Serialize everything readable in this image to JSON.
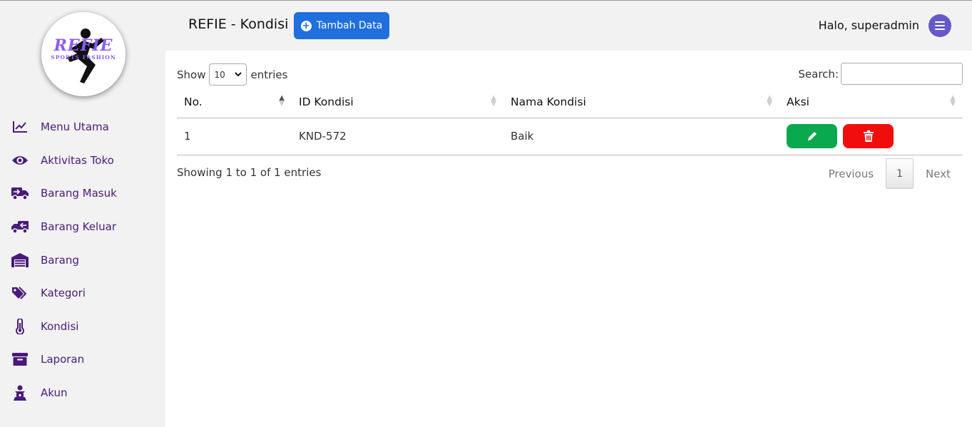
{
  "logo": {
    "text": "REFIE",
    "subtext": "SPORTS FASHION"
  },
  "sidebar": {
    "items": [
      {
        "label": "Menu Utama",
        "icon": "chart-line-icon"
      },
      {
        "label": "Aktivitas Toko",
        "icon": "eye-icon"
      },
      {
        "label": "Barang Masuk",
        "icon": "truck-arrow-in-icon"
      },
      {
        "label": "Barang Keluar",
        "icon": "truck-arrow-out-icon"
      },
      {
        "label": "Barang",
        "icon": "warehouse-icon"
      },
      {
        "label": "Kategori",
        "icon": "tags-icon"
      },
      {
        "label": "Kondisi",
        "icon": "thermometer-icon"
      },
      {
        "label": "Laporan",
        "icon": "archive-icon"
      },
      {
        "label": "Akun",
        "icon": "user-group-icon"
      }
    ]
  },
  "header": {
    "title": "REFIE - Kondisi",
    "add_button": "Tambah Data",
    "greeting": "Halo, superadmin"
  },
  "table_controls": {
    "show_label": "Show",
    "entries_value": "10",
    "entries_label": "entries",
    "search_label": "Search:",
    "search_value": ""
  },
  "table": {
    "columns": [
      "No.",
      "ID Kondisi",
      "Nama Kondisi",
      "Aksi"
    ],
    "rows": [
      {
        "no": "1",
        "id": "KND-572",
        "nama": "Baik"
      }
    ]
  },
  "footer": {
    "info": "Showing 1 to 1 of 1 entries",
    "previous": "Previous",
    "page": "1",
    "next": "Next"
  },
  "colors": {
    "accent": "#4a1a7a",
    "add_button": "#1f6fdc",
    "edit": "#0aa84f",
    "delete": "#f20d0d",
    "menu_button": "#6658c8"
  }
}
